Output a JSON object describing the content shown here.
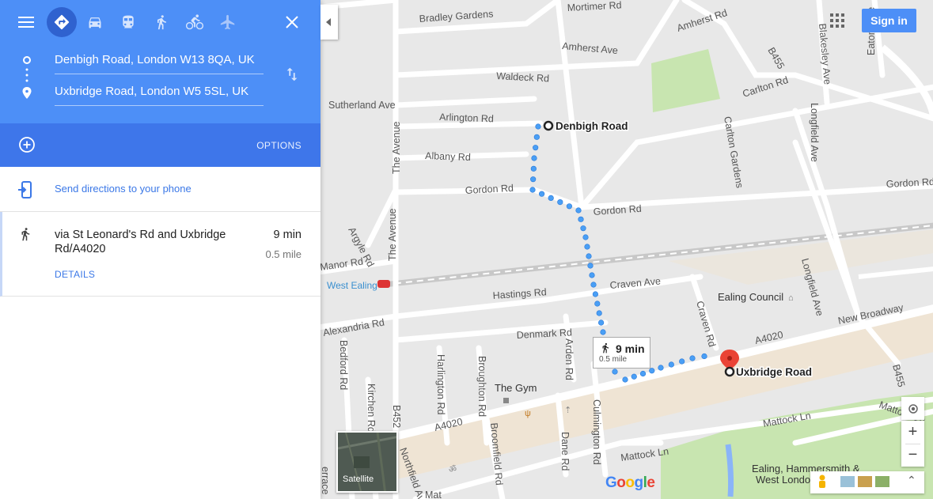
{
  "topbar": {
    "menu_icon": "menu-icon",
    "modes": [
      "directions-icon",
      "car-icon",
      "transit-icon",
      "walk-icon",
      "bike-icon",
      "flight-icon"
    ],
    "close_icon": "close-icon"
  },
  "directions": {
    "origin": "Denbigh Road, London W13 8QA, UK",
    "destination": "Uxbridge Road, London W5 5SL, UK",
    "swap_icon": "swap-icon",
    "add_icon": "add-destination-icon",
    "options_label": "OPTIONS"
  },
  "send": {
    "label": "Send directions to your phone"
  },
  "route": {
    "via": "via St Leonard's Rd and Uxbridge Rd/A4020",
    "time": "9 min",
    "distance": "0.5 mile",
    "details_label": "DETAILS"
  },
  "header": {
    "signin_label": "Sign in"
  },
  "map": {
    "callout_time": "9 min",
    "callout_distance": "0.5 mile",
    "origin_label": "Denbigh Road",
    "destination_label": "Uxbridge Road",
    "satellite_label": "Satellite",
    "google_logo": "Google",
    "colors": {
      "route": "#4a9ff5",
      "pin": "#ea4335",
      "panel": "#4d8ff7",
      "park": "#c8e5b0"
    },
    "roads": [
      "Bradley Gardens",
      "Mortimer Rd",
      "Amherst Rd",
      "Amherst Ave",
      "Waldeck Rd",
      "Sutherland Ave",
      "Arlington Rd",
      "Albany Rd",
      "Gordon Rd",
      "Gordon Rd",
      "Gordon Rd",
      "Carlton Rd",
      "Carlton Gardens",
      "Blakesley Ave",
      "Eaton Rise",
      "Longfield Ave",
      "Longfield Ave",
      "Hastings Rd",
      "Craven Ave",
      "Craven Rd",
      "Denmark Rd",
      "Manor Rd",
      "Alexandria Rd",
      "Argyle Rd",
      "The Avenue",
      "The Avenue",
      "Bedford Rd",
      "Kirchen Rd",
      "Harlington Rd",
      "Broughton Rd",
      "Arden Rd",
      "Culmington Rd",
      "Broomfield Rd",
      "Dane Rd",
      "Mattock Ln",
      "Mattock Ln",
      "Mattock Ln",
      "New Broadway",
      "A4020",
      "A4020",
      "B455",
      "B455",
      "B452",
      "Northfield Av",
      "Mat",
      "errace"
    ],
    "places": [
      "Ealing Council",
      "The Gym",
      "West Ealing",
      "Ealing, Hammersmith &",
      "West London"
    ]
  }
}
